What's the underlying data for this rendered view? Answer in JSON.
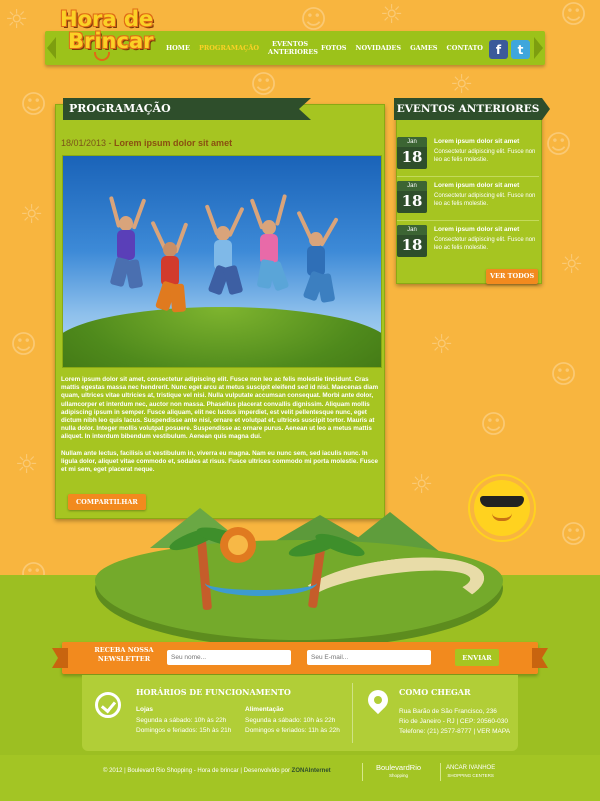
{
  "logo": {
    "line1": "Hora de",
    "line2": "Brincar"
  },
  "nav": [
    {
      "label": "HOME"
    },
    {
      "label": "PROGRAMAÇÃO",
      "active": true
    },
    {
      "label": "EVENTOS\nANTERIORES"
    },
    {
      "label": "FOTOS"
    },
    {
      "label": "NOVIDADES"
    },
    {
      "label": "GAMES"
    },
    {
      "label": "CONTATO"
    }
  ],
  "social": {
    "facebook_icon": "f",
    "twitter_icon": "t"
  },
  "main": {
    "section_title": "PROGRAMAÇÃO",
    "post_date": "18/01/2013",
    "post_separator": " - ",
    "post_title": "Lorem ipsum dolor sit amet",
    "paragraph1": "Lorem ipsum dolor sit amet, consectetur adipiscing elit. Fusce non leo ac felis molestie tincidunt. Cras mattis egestas massa nec hendrerit. Nunc eget arcu at metus suscipit eleifend sed id nisi. Maecenas diam quam, ultrices vitae ultricies at, tristique vel nisi. Nulla vulputate accumsan consequat. Morbi ante dolor, ullamcorper et interdum nec, auctor non massa. Phasellus placerat convallis dignissim. Aliquam mollis adipiscing ipsum in semper. Fusce aliquam, elit nec luctus imperdiet, est velit pellentesque nunc, eget dictum nibh leo quis lacus. Suspendisse ante nisi, ornare et volutpat et, ultrices suscipit tortor. Mauris at nulla dolor. Integer mollis volutpat posuere. Suspendisse ac ornare purus. Aenean ut leo a metus mattis aliquet. In interdum bibendum vestibulum. Aenean quis magna dui.",
    "paragraph2": "Nullam ante lectus, facilisis ut vestibulum in, viverra eu magna. Nam eu nunc sem, sed iaculis nunc. In ligula dolor, aliquet vitae commodo et, sodales at risus. Fusce ultrices commodo mi porta molestie. Fusce et mi sem, eget placerat neque.",
    "share_button": "COMPARTILHAR"
  },
  "sidebar": {
    "title": "EVENTOS ANTERIORES",
    "events": [
      {
        "month": "Jan",
        "day": "18",
        "title": "Lorem ipsum dolor sit amet",
        "desc": "Consectetur adipiscing elit. Fusce non leo ac felis molestie."
      },
      {
        "month": "Jan",
        "day": "18",
        "title": "Lorem ipsum dolor sit amet",
        "desc": "Consectetur adipiscing elit. Fusce non leo ac felis molestie."
      },
      {
        "month": "Jan",
        "day": "18",
        "title": "Lorem ipsum dolor sit amet",
        "desc": "Consectetur adipiscing elit. Fusce non leo ac felis molestie."
      }
    ],
    "view_all": "VER TODOS"
  },
  "newsletter": {
    "label": "RECEBA NOSSA\nNEWSLETTER",
    "name_placeholder": "Seu nome...",
    "email_placeholder": "Seu E-mail...",
    "submit": "ENVIAR"
  },
  "hours": {
    "title": "HORÁRIOS DE FUNCIONAMENTO",
    "col1_title": "Lojas",
    "col1_text": "Segunda a sábado: 10h às 22h\nDomingos e feriados: 15h às 21h",
    "col2_title": "Alimentação",
    "col2_text": "Segunda a sábado: 10h às 22h\nDomingos e feriados: 11h às 22h"
  },
  "location": {
    "title": "COMO CHEGAR",
    "address": "Rua Barão de São Francisco, 236\nRio de Janeiro - RJ | CEP: 20560-030\nTelefone: (21) 2577-8777 | VER MAPA"
  },
  "footer": {
    "copyright": "© 2012 | Boulevard Rio Shopping - Hora de brincar | Desenvolvido por ",
    "developer": "ZONAInternet",
    "partner1": "BoulevardRio",
    "partner1_sub": "Shopping",
    "partner2": "ANCAR IVANHOE",
    "partner2_sub": "SHOPPING CENTERS"
  }
}
